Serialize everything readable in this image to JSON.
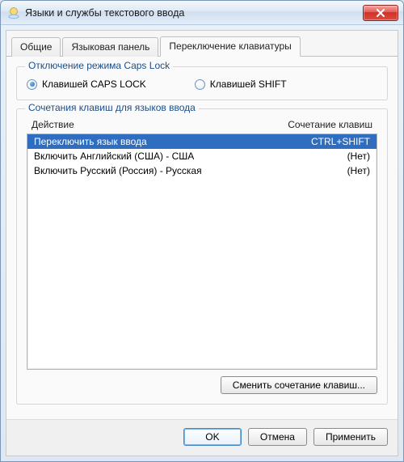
{
  "window": {
    "title": "Языки и службы текстового ввода"
  },
  "tabs": [
    {
      "label": "Общие"
    },
    {
      "label": "Языковая панель"
    },
    {
      "label": "Переключение клавиатуры"
    }
  ],
  "capslock_group": {
    "legend": "Отключение режима Caps Lock",
    "option_caps": "Клавишей CAPS LOCK",
    "option_shift": "Клавишей SHIFT"
  },
  "hotkeys_group": {
    "legend": "Сочетания клавиш для языков ввода",
    "col_action": "Действие",
    "col_combo": "Сочетание клавиш",
    "rows": [
      {
        "action": "Переключить язык ввода",
        "combo": "CTRL+SHIFT",
        "selected": true
      },
      {
        "action": "Включить Английский (США) - США",
        "combo": "(Нет)",
        "selected": false
      },
      {
        "action": "Включить Русский (Россия) - Русская",
        "combo": "(Нет)",
        "selected": false
      }
    ],
    "change_btn": "Сменить сочетание клавиш..."
  },
  "footer": {
    "ok": "OK",
    "cancel": "Отмена",
    "apply": "Применить"
  }
}
